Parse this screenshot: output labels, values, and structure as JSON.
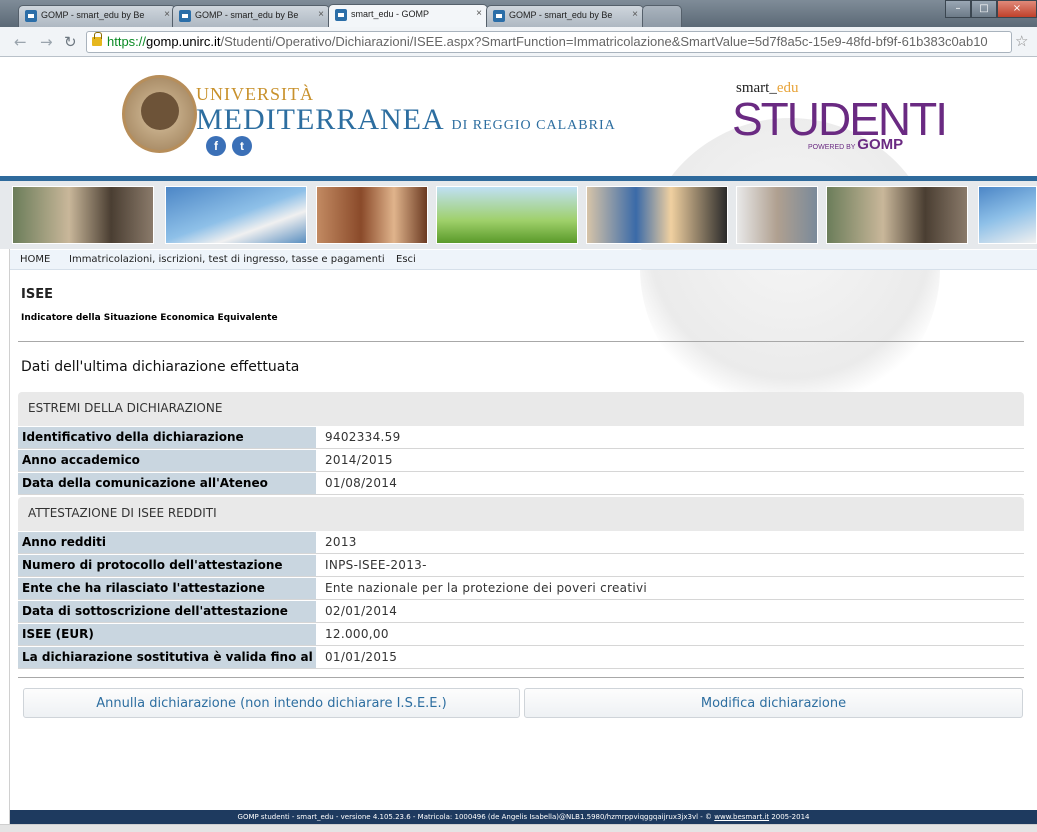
{
  "browser": {
    "tabs": [
      {
        "title": "GOMP - smart_edu by Be",
        "active": false
      },
      {
        "title": "GOMP - smart_edu by Be",
        "active": false
      },
      {
        "title": "smart_edu - GOMP",
        "active": true
      },
      {
        "title": "GOMP - smart_edu by Be",
        "active": false
      }
    ],
    "url_scheme": "https://",
    "url_host": "gomp.unirc.it",
    "url_path": "/Studenti/Operativo/Dichiarazioni/ISEE.aspx?SmartFunction=Immatricolazione&SmartValue=5d7f8a5c-15e9-48fd-bf9f-61b383c0ab10"
  },
  "header": {
    "university_line1": "UNIVERSITÀ",
    "university_line2": "MEDITERRANEA",
    "university_line3": "DI REGGIO CALABRIA",
    "seal_text": "Mediterranea",
    "facebook_glyph": "f",
    "twitter_glyph": "t",
    "app_smart": "smart_",
    "app_edu": "edu",
    "app_name": "STUDENTI",
    "powered_by": "POWERED BY",
    "powered_brand": "GOMP"
  },
  "menu": {
    "home": "HOME",
    "immatricolazioni": "Immatricolazioni, iscrizioni, test di ingresso, tasse e pagamenti",
    "esci": "Esci"
  },
  "page": {
    "title": "ISEE",
    "subtitle": "Indicatore della Situazione Economica Equivalente",
    "section_title": "Dati dell'ultima dichiarazione effettuata"
  },
  "estremi": {
    "heading": "ESTREMI DELLA DICHIARAZIONE",
    "rows": [
      {
        "label": "Identificativo della dichiarazione",
        "value": "9402334.59"
      },
      {
        "label": "Anno accademico",
        "value": "2014/2015"
      },
      {
        "label": "Data della comunicazione all'Ateneo",
        "value": "01/08/2014"
      }
    ]
  },
  "attestazione": {
    "heading": "ATTESTAZIONE DI ISEE REDDITI",
    "rows": [
      {
        "label": "Anno redditi",
        "value": "2013"
      },
      {
        "label": "Numero di protocollo dell'attestazione",
        "value": "INPS-ISEE-2013-"
      },
      {
        "label": "Ente che ha rilasciato l'attestazione",
        "value": "Ente nazionale per la protezione dei poveri creativi"
      },
      {
        "label": "Data di sottoscrizione dell'attestazione",
        "value": "02/01/2014"
      },
      {
        "label": "ISEE (EUR)",
        "value": "12.000,00"
      },
      {
        "label": "La dichiarazione sostitutiva è valida fino al",
        "value": "01/01/2015"
      }
    ]
  },
  "buttons": {
    "annulla": "Annulla dichiarazione (non intendo dichiarare I.S.E.E.)",
    "modifica": "Modifica dichiarazione"
  },
  "footer": {
    "text": "GOMP studenti - smart_edu - versione 4.105.23.6 - Matricola: 1000496 (de Angelis Isabella)@NLB1.5980/hzmrppviqggqaijrux3jx3vl - © ",
    "link": "www.besmart.it",
    "years": " 2005-2014"
  },
  "colors": {
    "accent_blue": "#2d6ea0",
    "brand_purple": "#6a2a82",
    "label_bg": "#c9d6e0",
    "footer_bg": "#1e3a5f"
  }
}
